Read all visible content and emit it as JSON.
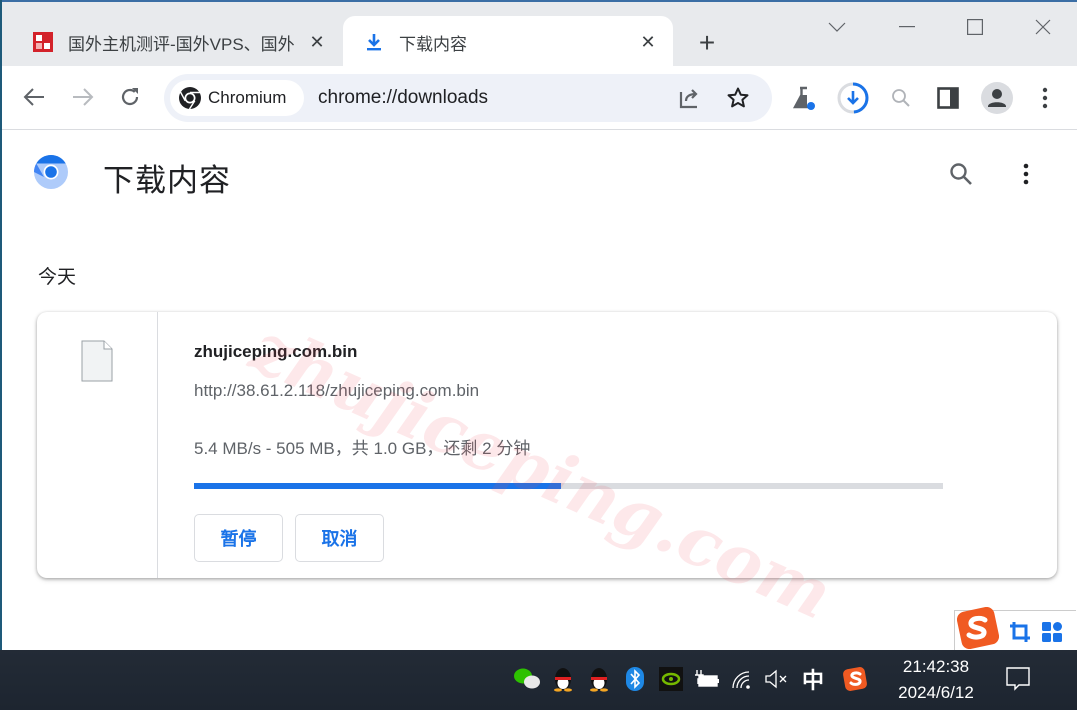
{
  "browser": {
    "tabs": [
      {
        "title": "国外主机测评-国外VPS、国外",
        "favicon": "site-seal-icon",
        "active": false
      },
      {
        "title": "下载内容",
        "favicon": "download-icon",
        "active": true
      }
    ],
    "new_tab_label": "+",
    "window_controls": [
      "tab-search",
      "minimize",
      "maximize",
      "close"
    ],
    "omnibox": {
      "chip_label": "Chromium",
      "url": "chrome://downloads"
    },
    "toolbar_icons": [
      "share-icon",
      "bookmark-star-icon",
      "labs-flask-icon",
      "download-progress-icon",
      "zoom-icon",
      "side-panel-icon",
      "profile-avatar-icon",
      "menu-kebab-icon"
    ],
    "download_ring_progress": 0.49
  },
  "page": {
    "title": "下载内容",
    "section_label": "今天",
    "download": {
      "filename": "zhujiceping.com.bin",
      "url": "http://38.61.2.118/zhujiceping.com.bin",
      "status": "5.4 MB/s - 505 MB，共 1.0 GB，还剩 2 分钟",
      "progress_fraction": 0.49,
      "pause_label": "暂停",
      "cancel_label": "取消"
    },
    "watermark": "zhujiceping.com"
  },
  "taskbar": {
    "tray_icons": [
      "wechat-icon",
      "qq-icon",
      "qq-icon",
      "bluetooth-icon",
      "nvidia-icon",
      "battery-charging-icon",
      "wifi-icon",
      "volume-muted-icon",
      "ime-chinese-icon",
      "sogou-icon"
    ],
    "ime_label": "中",
    "time": "21:42:38",
    "date": "2024/6/12"
  },
  "colors": {
    "accent": "#1a73e8",
    "taskbar": "#1f2937",
    "tabstrip": "#e8eaed"
  }
}
